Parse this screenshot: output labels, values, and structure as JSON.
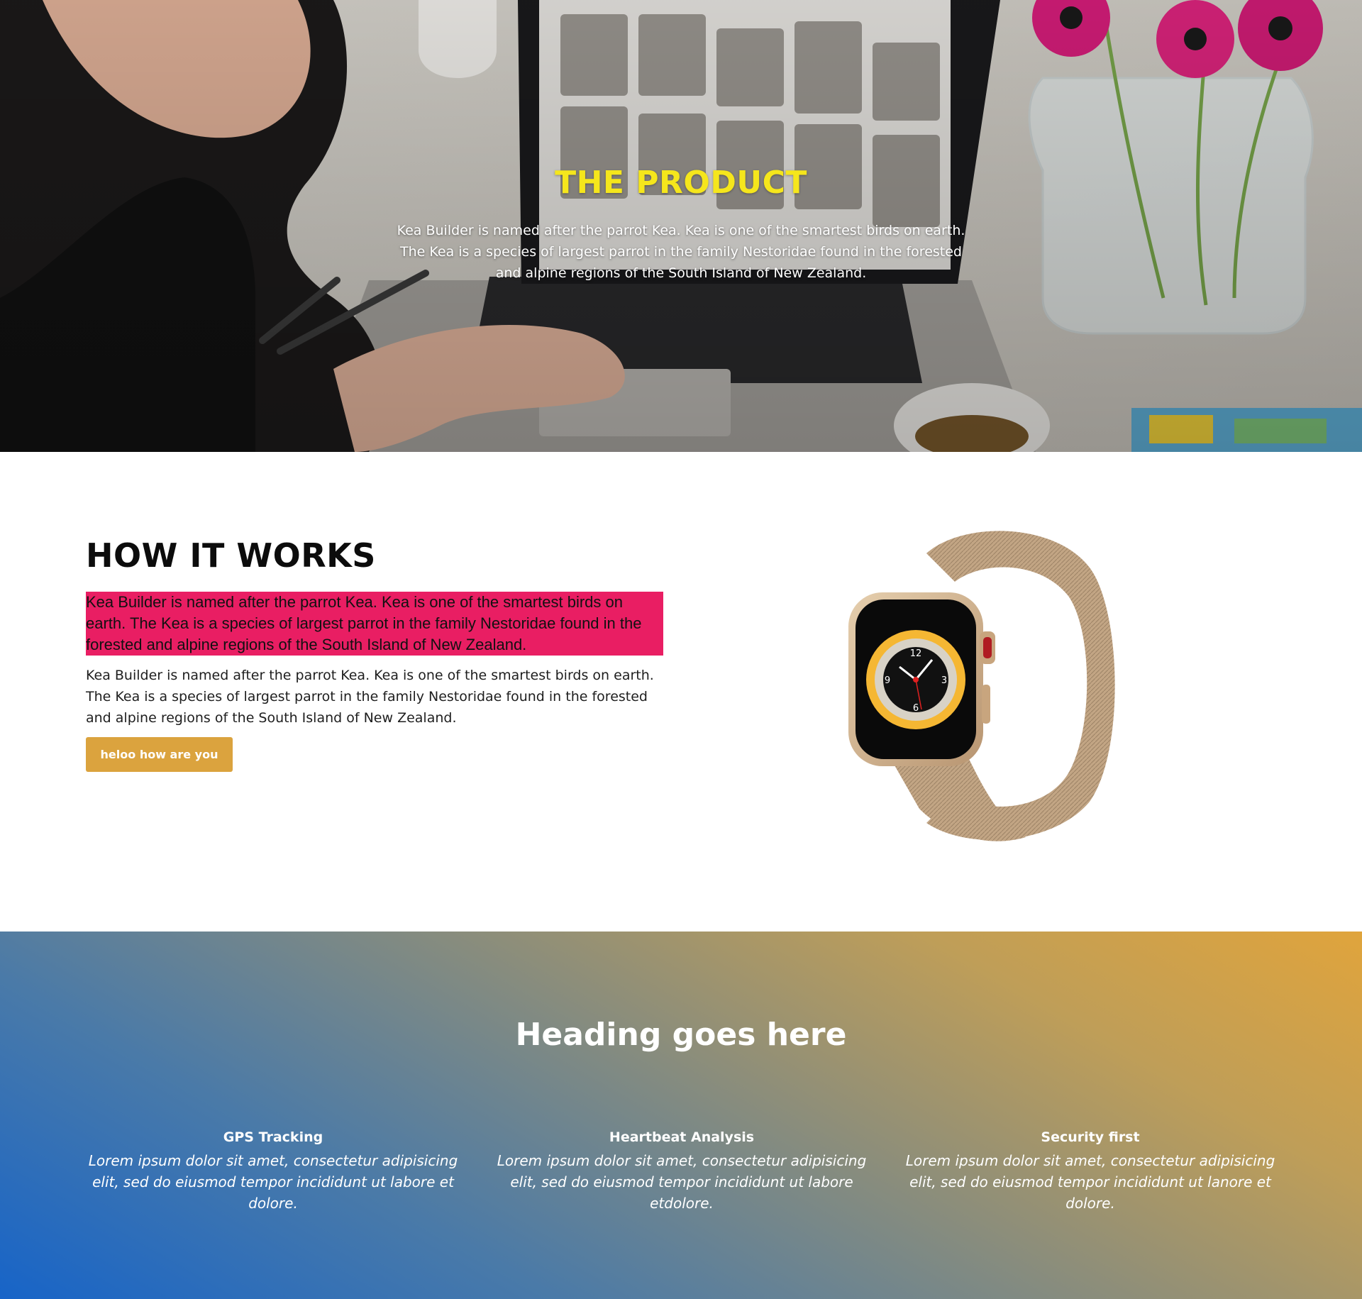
{
  "hero": {
    "title": "THE PRODUCT",
    "text": "Kea Builder is named after the parrot Kea. Kea is one of the smartest birds on earth. The Kea is a species of largest parrot in the family Nestoridae found in the forested and alpine regions of the South Island of New Zealand.",
    "background_image": "person-at-laptop-desk-photo"
  },
  "how_it_works": {
    "title": "HOW IT WORKS",
    "highlight_text": "Kea Builder is named after the parrot Kea. Kea is one of the smartest birds on earth. The Kea is a species of largest parrot in the family Nestoridae found in the forested and alpine regions of the South Island of New Zealand.",
    "highlight_color": "#e91e63",
    "body_text": "Kea Builder is named after the parrot Kea. Kea is one of the smartest birds on earth. The Kea is a species of largest parrot in the family Nestoridae found in the forested and alpine regions of the South Island of New Zealand.",
    "button_label": "heloo how are you",
    "button_color": "#dba33e",
    "image": "gold-smartwatch-image"
  },
  "features": {
    "title": "Heading goes here",
    "gradient_start": "#1764c8",
    "gradient_end": "#e0a43c",
    "items": [
      {
        "title": "GPS Tracking",
        "text": "Lorem ipsum dolor sit amet, consectetur adipisicing elit, sed do eiusmod tempor incididunt ut labore et dolore."
      },
      {
        "title": "Heartbeat Analysis",
        "text": "Lorem ipsum dolor sit amet, consectetur adipisicing elit, sed do eiusmod tempor incididunt ut labore etdolore."
      },
      {
        "title": "Security first",
        "text": "Lorem ipsum dolor sit amet, consectetur adipisicing elit, sed do eiusmod tempor incididunt ut lanore et dolore."
      }
    ]
  }
}
